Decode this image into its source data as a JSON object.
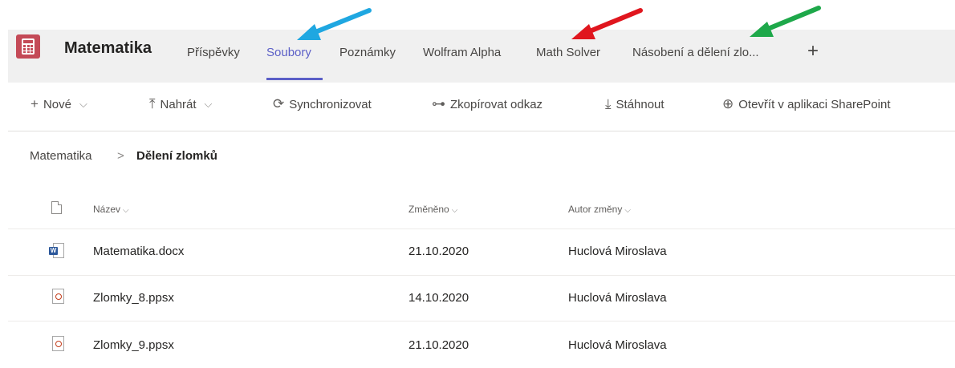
{
  "team": {
    "name": "Matematika"
  },
  "tabs": [
    {
      "label": "Příspěvky"
    },
    {
      "label": "Soubory"
    },
    {
      "label": "Poznámky"
    },
    {
      "label": "Wolfram Alpha"
    },
    {
      "label": "Math Solver"
    },
    {
      "label": "Násobení a dělení zlo..."
    }
  ],
  "add_tab": "+",
  "toolbar": {
    "new": "Nové",
    "upload": "Nahrát",
    "sync": "Synchronizovat",
    "copy_link": "Zkopírovat odkaz",
    "download": "Stáhnout",
    "open_sharepoint": "Otevřít v aplikaci SharePoint"
  },
  "breadcrumb": {
    "parent": "Matematika",
    "separator": ">",
    "current": "Dělení zlomků"
  },
  "columns": {
    "name": "Název",
    "modified": "Změněno",
    "modified_by": "Autor změny"
  },
  "files": [
    {
      "name": "Matematika.docx",
      "modified": "21.10.2020",
      "author": "Huclová Miroslava",
      "icon": "word-icon"
    },
    {
      "name": "Zlomky_8.ppsx",
      "modified": "14.10.2020",
      "author": "Huclová Miroslava",
      "icon": "powerpoint-icon"
    },
    {
      "name": "Zlomky_9.ppsx",
      "modified": "21.10.2020",
      "author": "Huclová Miroslava",
      "icon": "powerpoint-icon"
    }
  ],
  "colors": {
    "accent": "#5b5fc7",
    "app_icon": "#c44a57",
    "arrow_blue": "#1fa7e1",
    "arrow_red": "#e0161e",
    "arrow_green": "#1ea84a"
  }
}
